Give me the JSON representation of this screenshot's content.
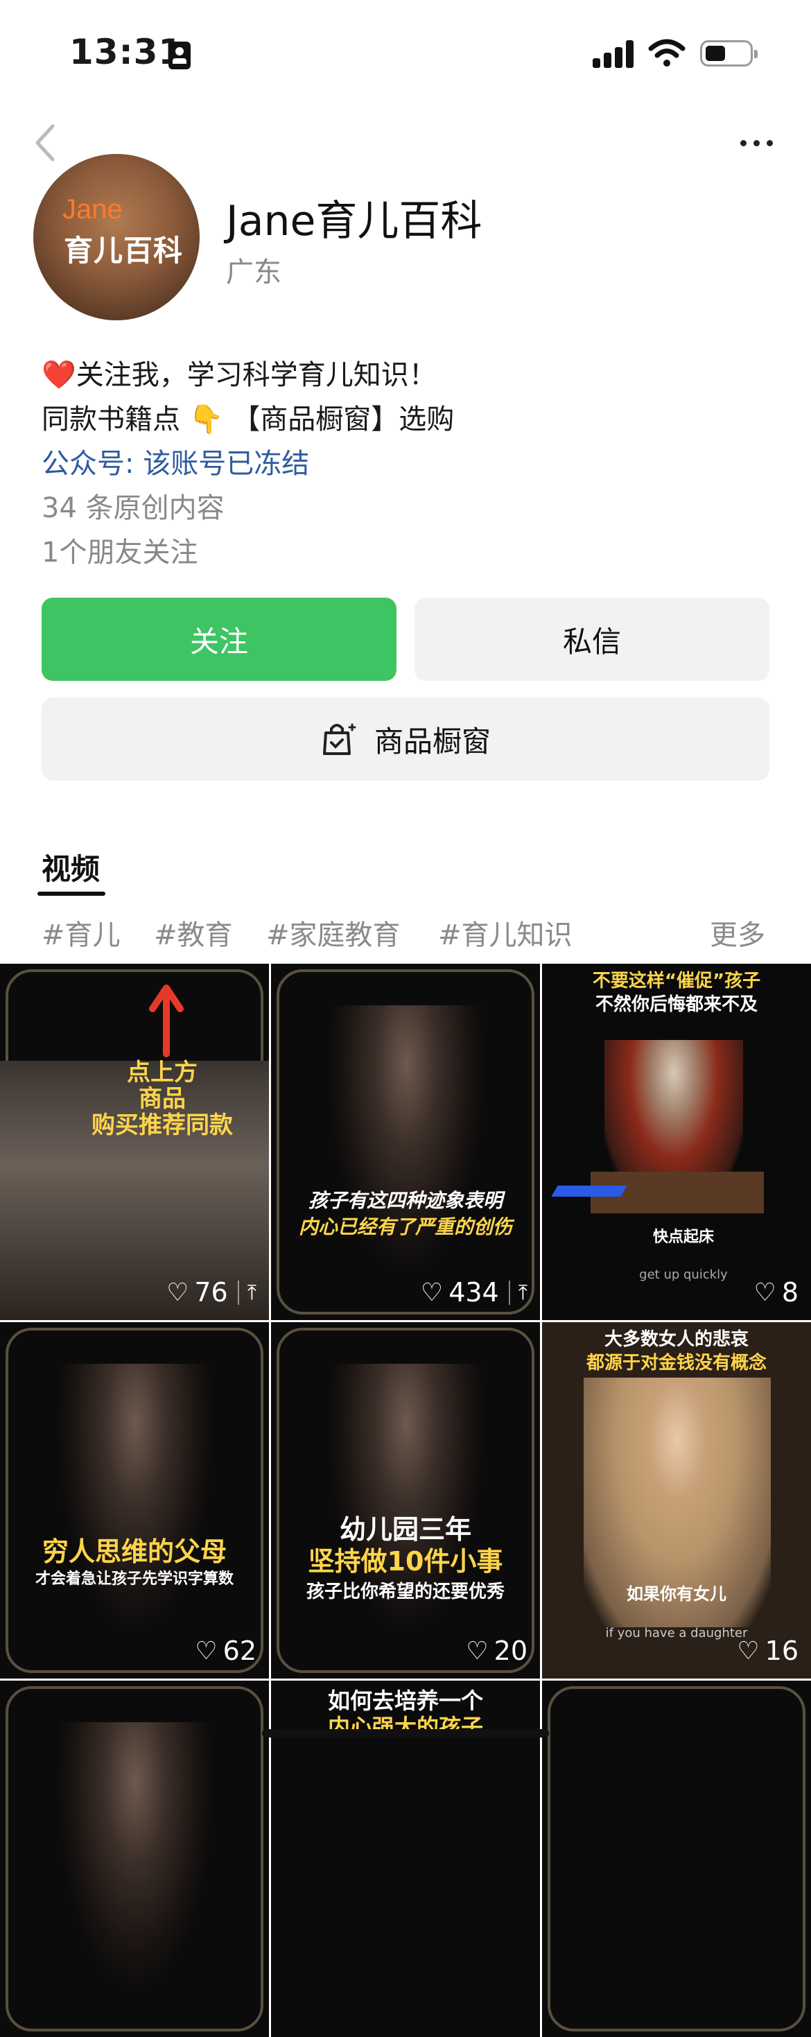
{
  "status_bar": {
    "time": "13:31"
  },
  "profile": {
    "avatar_brand": "Jane",
    "avatar_sub": "育儿百科",
    "name": "Jane育儿百科",
    "region": "广东",
    "bio": [
      "❤️关注我，学习科学育儿知识！",
      "同款书籍点 👇 【商品橱窗】选购",
      "公众号: 该账号已冻结",
      "34 条原创内容",
      "1个朋友关注"
    ]
  },
  "actions": {
    "follow": "关注",
    "message": "私信",
    "shop": "商品橱窗"
  },
  "tabs": {
    "video": "视频"
  },
  "tags": [
    "#育儿",
    "#教育",
    "#家庭教育",
    "#育儿知识",
    "更多"
  ],
  "videos": [
    {
      "caption_lines": [
        "点上方",
        "商品",
        "购买推荐同款"
      ],
      "likes": "76",
      "pinned": true
    },
    {
      "caption_lines": [
        "孩子有这四种迹象表明",
        "内心已经有了严重的创伤"
      ],
      "likes": "434",
      "pinned": true
    },
    {
      "caption_lines": [
        "不要这样“催促”孩子",
        "不然你后悔都来不及",
        "快点起床",
        "get up quickly"
      ],
      "likes": "8",
      "pinned": false
    },
    {
      "caption_lines": [
        "穷人思维的父母",
        "才会着急让孩子先学识字算数"
      ],
      "likes": "62",
      "pinned": false
    },
    {
      "caption_lines": [
        "幼儿园三年",
        "坚持做10件小事",
        "孩子比你希望的还要优秀"
      ],
      "likes": "20",
      "pinned": false
    },
    {
      "caption_lines": [
        "大多数女人的悲哀",
        "都源于对金钱没有概念",
        "如果你有女儿",
        "if you have a daughter"
      ],
      "likes": "16",
      "pinned": false
    },
    {
      "caption_lines": [],
      "likes": "",
      "pinned": false
    },
    {
      "caption_lines": [
        "如何去培养一个",
        "内心强大的孩子"
      ],
      "likes": "",
      "pinned": false
    },
    {
      "caption_lines": [],
      "likes": "",
      "pinned": false
    }
  ],
  "colors": {
    "follow_green": "#3fc464",
    "link_blue": "#2f5b9e",
    "caption_yellow": "#ffd54a"
  }
}
